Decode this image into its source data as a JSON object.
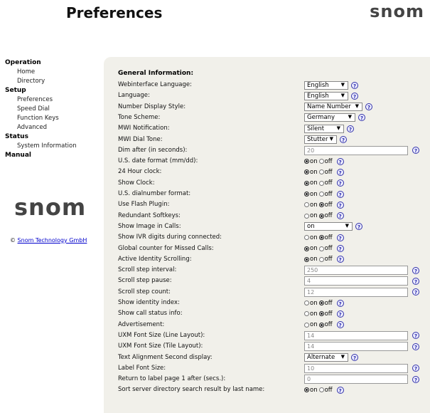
{
  "header": {
    "title": "Preferences",
    "logo": "snom"
  },
  "sidebar": {
    "sections": [
      {
        "label": "Operation",
        "items": [
          "Home",
          "Directory"
        ]
      },
      {
        "label": "Setup",
        "items": [
          "Preferences",
          "Speed Dial",
          "Function Keys",
          "Advanced"
        ]
      },
      {
        "label": "Status",
        "items": [
          "System Information"
        ]
      },
      {
        "label": "Manual",
        "items": []
      }
    ],
    "logo": "snom",
    "copyright_symbol": "©",
    "copyright_link": "Snom Technology GmbH"
  },
  "main": {
    "section_title": "General Information:",
    "rows": [
      {
        "label": "Webinterface Language:",
        "type": "select",
        "value": "English"
      },
      {
        "label": "Language:",
        "type": "select",
        "value": "English"
      },
      {
        "label": "Number Display Style:",
        "type": "select",
        "value": "Name Number"
      },
      {
        "label": "Tone Scheme:",
        "type": "select",
        "value": "Germany"
      },
      {
        "label": "MWI Notification:",
        "type": "select",
        "value": "Silent"
      },
      {
        "label": "MWI Dial Tone:",
        "type": "select",
        "value": "Stutter"
      },
      {
        "label": "Dim after (in seconds):",
        "type": "text",
        "value": "20"
      },
      {
        "label": "U.S. date format (mm/dd):",
        "type": "radio",
        "value": "on"
      },
      {
        "label": "24 Hour clock:",
        "type": "radio",
        "value": "on"
      },
      {
        "label": "Show Clock:",
        "type": "radio",
        "value": "on"
      },
      {
        "label": "U.S. dialnumber format:",
        "type": "radio",
        "value": "on"
      },
      {
        "label": "Use Flash Plugin:",
        "type": "radio",
        "value": "off"
      },
      {
        "label": "Redundant Softkeys:",
        "type": "radio",
        "value": "off"
      },
      {
        "label": "Show Image in Calls:",
        "type": "select",
        "value": "on"
      },
      {
        "label": "Show IVR digits during connected:",
        "type": "radio",
        "value": "off"
      },
      {
        "label": "Global counter for Missed Calls:",
        "type": "radio",
        "value": "on"
      },
      {
        "label": "Active Identity Scrolling:",
        "type": "radio",
        "value": "on"
      },
      {
        "label": "Scroll step interval:",
        "type": "text",
        "value": "250"
      },
      {
        "label": "Scroll step pause:",
        "type": "text",
        "value": "4"
      },
      {
        "label": "Scroll step count:",
        "type": "text",
        "value": "12"
      },
      {
        "label": "Show identity index:",
        "type": "radio",
        "value": "off"
      },
      {
        "label": "Show call status info:",
        "type": "radio",
        "value": "off"
      },
      {
        "label": "Advertisement:",
        "type": "radio",
        "value": "off"
      },
      {
        "label": "UXM Font Size (Line Layout):",
        "type": "text",
        "value": "14"
      },
      {
        "label": "UXM Font Size (Tile Layout):",
        "type": "text",
        "value": "14"
      },
      {
        "label": "Text Alignment Second display:",
        "type": "select",
        "value": "Alternate"
      },
      {
        "label": "Label Font Size:",
        "type": "text",
        "value": "10"
      },
      {
        "label": "Return to label page 1 after (secs.):",
        "type": "text",
        "value": "0"
      },
      {
        "label": "Sort server directory search result by last name:",
        "type": "radio",
        "value": "on"
      }
    ],
    "radio_labels": {
      "on": "on",
      "off": "off"
    },
    "help_glyph": "?",
    "select_arrow": "▼"
  }
}
